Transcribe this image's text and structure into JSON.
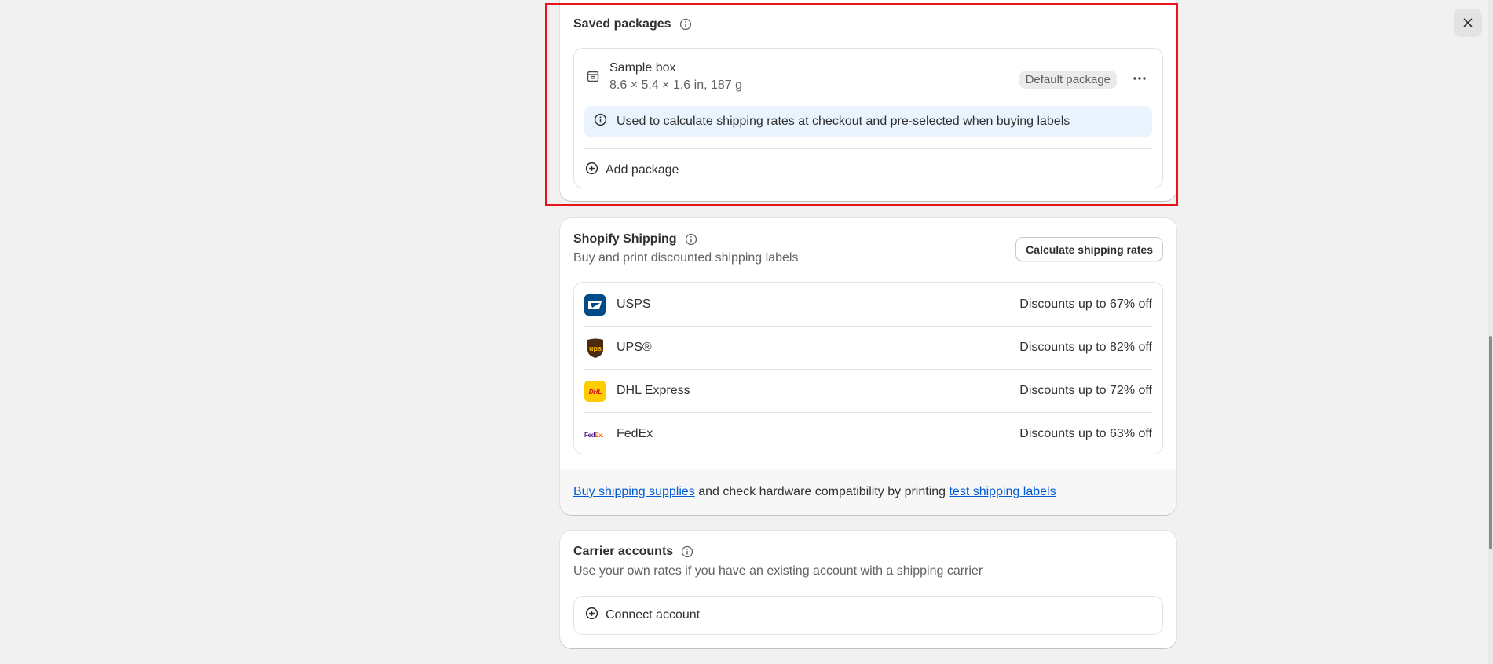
{
  "saved_packages": {
    "title": "Saved packages",
    "package": {
      "name": "Sample box",
      "dimensions": "8.6 × 5.4 × 1.6 in, 187 g",
      "badge": "Default package"
    },
    "banner_text": "Used to calculate shipping rates at checkout and pre-selected when buying labels",
    "add_label": "Add package"
  },
  "shopify_shipping": {
    "title": "Shopify Shipping",
    "subtitle": "Buy and print discounted shipping labels",
    "button_label": "Calculate shipping rates",
    "carriers": [
      {
        "name": "USPS",
        "discount": "Discounts up to 67% off",
        "logo_color": "#004b87"
      },
      {
        "name": "UPS®",
        "discount": "Discounts up to 82% off",
        "logo_color": "#4b2a12"
      },
      {
        "name": "DHL Express",
        "discount": "Discounts up to 72% off",
        "logo_color": "#ffcc00"
      },
      {
        "name": "FedEx",
        "discount": "Discounts up to 63% off",
        "logo_color": "#4d148c"
      }
    ],
    "footer": {
      "link1": "Buy shipping supplies",
      "middle": " and check hardware compatibility by printing ",
      "link2": "test shipping labels"
    }
  },
  "carrier_accounts": {
    "title": "Carrier accounts",
    "subtitle": "Use your own rates if you have an existing account with a shipping carrier",
    "connect_label": "Connect account"
  },
  "colors": {
    "highlight": "#e8141c",
    "link": "#005bd3",
    "banner_bg": "#eaf4ff",
    "page_bg": "#f1f1f1"
  },
  "logos": {
    "usps": "USPS",
    "ups": "ups",
    "dhl": "DHL",
    "fedex_fed": "Fed",
    "fedex_ex": "Ex."
  }
}
